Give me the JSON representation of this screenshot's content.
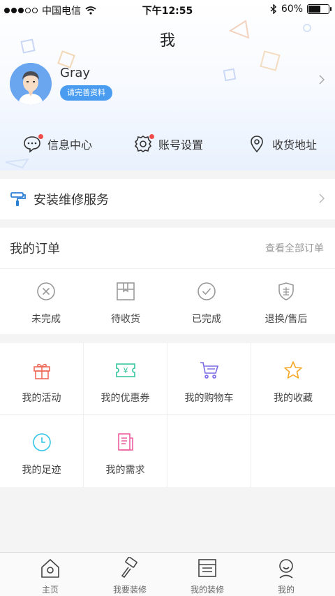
{
  "status_bar": {
    "carrier": "中国电信",
    "time": "下午12:55",
    "battery": "60%",
    "battery_level": 0.6
  },
  "page": {
    "title": "我"
  },
  "profile": {
    "name": "Gray",
    "complete_label": "请完善资料"
  },
  "quick_links": [
    {
      "label": "信息中心",
      "icon": "message-icon",
      "badge": true
    },
    {
      "label": "账号设置",
      "icon": "gear-icon",
      "badge": true
    },
    {
      "label": "收货地址",
      "icon": "location-pin-icon",
      "badge": false
    }
  ],
  "service": {
    "label": "安装维修服务",
    "icon": "paint-roller-icon"
  },
  "orders": {
    "title": "我的订单",
    "view_all": "查看全部订单",
    "items": [
      {
        "label": "未完成",
        "icon": "x-circle-icon"
      },
      {
        "label": "待收货",
        "icon": "package-icon"
      },
      {
        "label": "已完成",
        "icon": "check-circle-icon"
      },
      {
        "label": "退换/售后",
        "icon": "shield-sale-icon"
      }
    ]
  },
  "features": [
    {
      "label": "我的活动",
      "icon": "gift-icon",
      "color": "#f06b5a"
    },
    {
      "label": "我的优惠券",
      "icon": "coupon-icon",
      "color": "#2fc39a"
    },
    {
      "label": "我的购物车",
      "icon": "cart-icon",
      "color": "#7a6ae6"
    },
    {
      "label": "我的收藏",
      "icon": "star-icon",
      "color": "#f5a623"
    },
    {
      "label": "我的足迹",
      "icon": "clock-icon",
      "color": "#32c5e8"
    },
    {
      "label": "我的需求",
      "icon": "document-icon",
      "color": "#ec5fa0"
    }
  ],
  "tabbar": [
    {
      "label": "主页",
      "icon": "home-icon"
    },
    {
      "label": "我要装修",
      "icon": "hammer-icon"
    },
    {
      "label": "我的装修",
      "icon": "list-doc-icon"
    },
    {
      "label": "我的",
      "icon": "user-icon"
    }
  ]
}
